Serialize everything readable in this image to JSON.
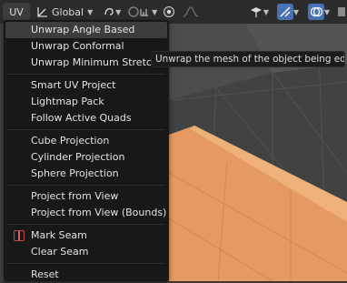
{
  "header": {
    "uv_menu_label": "UV",
    "pivot_label": "Global",
    "icons": [
      "orientation-icon",
      "pivot-icon",
      "snap-icon",
      "proportional-edit-icon",
      "falloff-icon",
      "overlay-icon",
      "gizmo-icon",
      "shading-icon"
    ]
  },
  "menu": {
    "unwrap_angle_based": "Unwrap Angle Based",
    "unwrap_conformal": "Unwrap Conformal",
    "unwrap_minimum_stretch": "Unwrap Minimum Stretch",
    "smart_uv_project": "Smart UV Project",
    "lightmap_pack": "Lightmap Pack",
    "follow_active_quads": "Follow Active Quads",
    "cube_projection": "Cube Projection",
    "cylinder_projection": "Cylinder Projection",
    "sphere_projection": "Sphere Projection",
    "project_from_view": "Project from View",
    "project_from_view_bounds": "Project from View (Bounds)",
    "mark_seam": "Mark Seam",
    "clear_seam": "Clear Seam",
    "reset": "Reset"
  },
  "tooltip": {
    "text": "Unwrap the mesh of the object being edited."
  },
  "colors": {
    "selected_face": "#e59a61",
    "header_bg": "#2b2b2b",
    "menu_bg": "#181818",
    "highlight": "#3d3d3d"
  }
}
